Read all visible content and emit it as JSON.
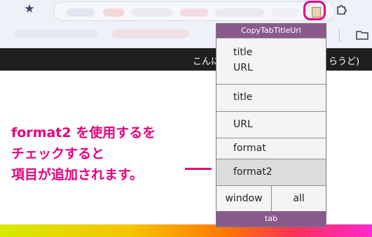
{
  "popup": {
    "title": "CopyTabTitleUrl",
    "items": [
      {
        "line1": "title",
        "line2": "URL"
      },
      {
        "label": "title"
      },
      {
        "label": "URL"
      },
      {
        "label": "format"
      },
      {
        "label": "format2"
      }
    ],
    "buttons": {
      "window": "window",
      "all": "all"
    },
    "footer": "tab"
  },
  "page": {
    "bar_text_left": "こんに",
    "bar_text_right": "くらうど)"
  },
  "annotation": {
    "line1": "format2 を使用するを",
    "line2": "チェックすると",
    "line3": "項目が追加されます。"
  },
  "colors": {
    "accent": "#e6007e",
    "popup_header": "#8b5a8d"
  }
}
